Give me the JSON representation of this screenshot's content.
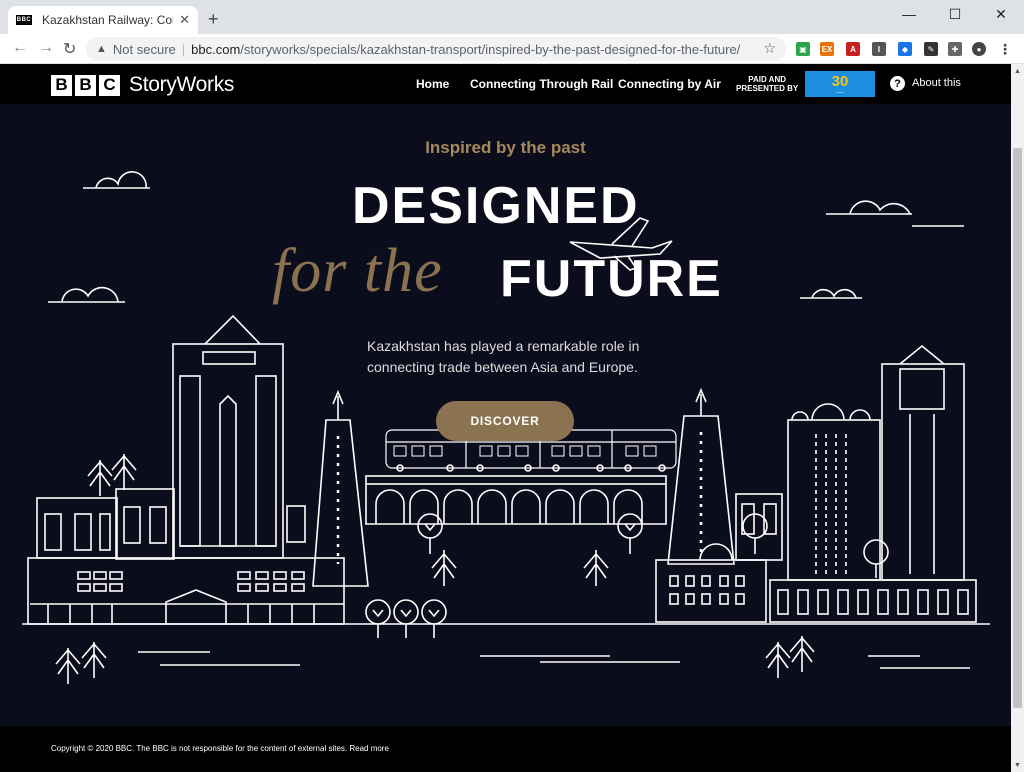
{
  "browser": {
    "tab_title": "Kazakhstan Railway: Connecting",
    "tab_favicon": "BBC",
    "url_warning": "Not secure",
    "url_host": "bbc.com",
    "url_path": "/storyworks/specials/kazakhstan-transport/inspired-by-the-past-designed-for-the-future/"
  },
  "header": {
    "logo_text": "StoryWorks",
    "logo_blocks": [
      "B",
      "B",
      "C"
    ],
    "nav": [
      "Home",
      "Connecting Through Rail",
      "Connecting by Air"
    ],
    "paid_line1": "PAID AND",
    "paid_line2": "PRESENTED BY",
    "sponsor_mark": "30",
    "about": "About this"
  },
  "hero": {
    "subtitle": "Inspired by the past",
    "title_line1": "DESIGNED",
    "title_italic": "for the",
    "title_bold": "FUTURE",
    "description": "Kazakhstan has played a remarkable role in connecting trade between Asia and Europe.",
    "cta": "DISCOVER"
  },
  "footer": {
    "text": "Copyright © 2020 BBC. The BBC is not responsible for the content of external sites. Read more"
  },
  "colors": {
    "background": "#0b0c1c",
    "gold": "#a6895a",
    "button": "#8b7352"
  }
}
